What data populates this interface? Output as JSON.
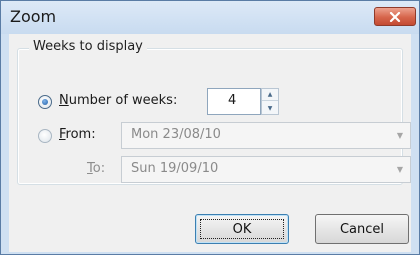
{
  "window": {
    "title": "Zoom",
    "close_icon": "close-x-icon",
    "accent_close": "#d6654b"
  },
  "group": {
    "legend": "Weeks to display"
  },
  "number_of_weeks": {
    "label_mnemonic": "N",
    "label_rest": "umber of weeks:",
    "value": "4",
    "selected": true
  },
  "from": {
    "label_mnemonic": "F",
    "label_rest": "rom:",
    "value": "Mon 23/08/10",
    "selected": false
  },
  "to": {
    "label_mnemonic": "T",
    "label_rest": "o:",
    "value": "Sun 19/09/10"
  },
  "buttons": {
    "ok": "OK",
    "cancel": "Cancel"
  }
}
